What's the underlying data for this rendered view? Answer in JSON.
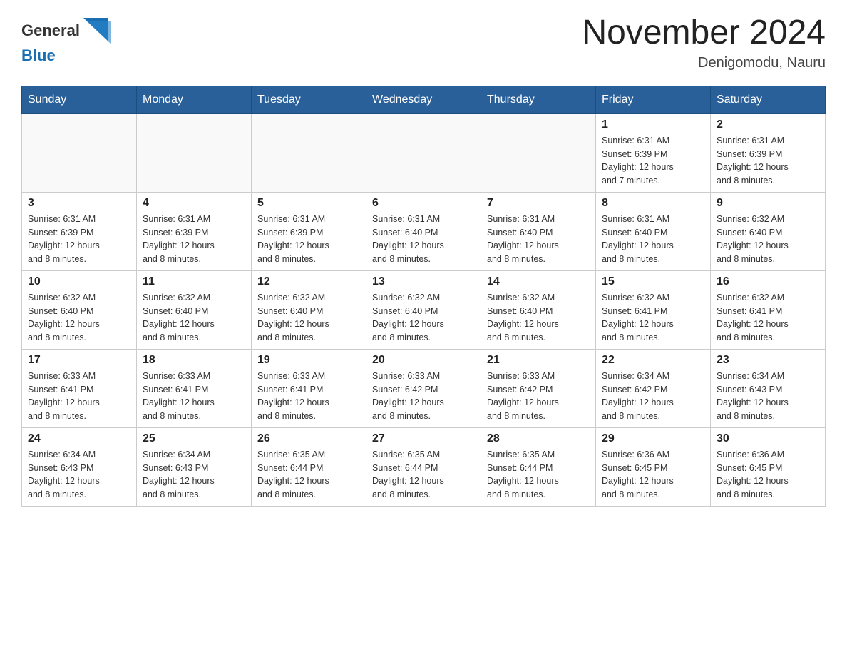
{
  "header": {
    "logo_general": "General",
    "logo_blue": "Blue",
    "month_title": "November 2024",
    "location": "Denigomodu, Nauru"
  },
  "weekdays": [
    "Sunday",
    "Monday",
    "Tuesday",
    "Wednesday",
    "Thursday",
    "Friday",
    "Saturday"
  ],
  "weeks": [
    [
      {
        "day": "",
        "info": ""
      },
      {
        "day": "",
        "info": ""
      },
      {
        "day": "",
        "info": ""
      },
      {
        "day": "",
        "info": ""
      },
      {
        "day": "",
        "info": ""
      },
      {
        "day": "1",
        "info": "Sunrise: 6:31 AM\nSunset: 6:39 PM\nDaylight: 12 hours\nand 7 minutes."
      },
      {
        "day": "2",
        "info": "Sunrise: 6:31 AM\nSunset: 6:39 PM\nDaylight: 12 hours\nand 8 minutes."
      }
    ],
    [
      {
        "day": "3",
        "info": "Sunrise: 6:31 AM\nSunset: 6:39 PM\nDaylight: 12 hours\nand 8 minutes."
      },
      {
        "day": "4",
        "info": "Sunrise: 6:31 AM\nSunset: 6:39 PM\nDaylight: 12 hours\nand 8 minutes."
      },
      {
        "day": "5",
        "info": "Sunrise: 6:31 AM\nSunset: 6:39 PM\nDaylight: 12 hours\nand 8 minutes."
      },
      {
        "day": "6",
        "info": "Sunrise: 6:31 AM\nSunset: 6:40 PM\nDaylight: 12 hours\nand 8 minutes."
      },
      {
        "day": "7",
        "info": "Sunrise: 6:31 AM\nSunset: 6:40 PM\nDaylight: 12 hours\nand 8 minutes."
      },
      {
        "day": "8",
        "info": "Sunrise: 6:31 AM\nSunset: 6:40 PM\nDaylight: 12 hours\nand 8 minutes."
      },
      {
        "day": "9",
        "info": "Sunrise: 6:32 AM\nSunset: 6:40 PM\nDaylight: 12 hours\nand 8 minutes."
      }
    ],
    [
      {
        "day": "10",
        "info": "Sunrise: 6:32 AM\nSunset: 6:40 PM\nDaylight: 12 hours\nand 8 minutes."
      },
      {
        "day": "11",
        "info": "Sunrise: 6:32 AM\nSunset: 6:40 PM\nDaylight: 12 hours\nand 8 minutes."
      },
      {
        "day": "12",
        "info": "Sunrise: 6:32 AM\nSunset: 6:40 PM\nDaylight: 12 hours\nand 8 minutes."
      },
      {
        "day": "13",
        "info": "Sunrise: 6:32 AM\nSunset: 6:40 PM\nDaylight: 12 hours\nand 8 minutes."
      },
      {
        "day": "14",
        "info": "Sunrise: 6:32 AM\nSunset: 6:40 PM\nDaylight: 12 hours\nand 8 minutes."
      },
      {
        "day": "15",
        "info": "Sunrise: 6:32 AM\nSunset: 6:41 PM\nDaylight: 12 hours\nand 8 minutes."
      },
      {
        "day": "16",
        "info": "Sunrise: 6:32 AM\nSunset: 6:41 PM\nDaylight: 12 hours\nand 8 minutes."
      }
    ],
    [
      {
        "day": "17",
        "info": "Sunrise: 6:33 AM\nSunset: 6:41 PM\nDaylight: 12 hours\nand 8 minutes."
      },
      {
        "day": "18",
        "info": "Sunrise: 6:33 AM\nSunset: 6:41 PM\nDaylight: 12 hours\nand 8 minutes."
      },
      {
        "day": "19",
        "info": "Sunrise: 6:33 AM\nSunset: 6:41 PM\nDaylight: 12 hours\nand 8 minutes."
      },
      {
        "day": "20",
        "info": "Sunrise: 6:33 AM\nSunset: 6:42 PM\nDaylight: 12 hours\nand 8 minutes."
      },
      {
        "day": "21",
        "info": "Sunrise: 6:33 AM\nSunset: 6:42 PM\nDaylight: 12 hours\nand 8 minutes."
      },
      {
        "day": "22",
        "info": "Sunrise: 6:34 AM\nSunset: 6:42 PM\nDaylight: 12 hours\nand 8 minutes."
      },
      {
        "day": "23",
        "info": "Sunrise: 6:34 AM\nSunset: 6:43 PM\nDaylight: 12 hours\nand 8 minutes."
      }
    ],
    [
      {
        "day": "24",
        "info": "Sunrise: 6:34 AM\nSunset: 6:43 PM\nDaylight: 12 hours\nand 8 minutes."
      },
      {
        "day": "25",
        "info": "Sunrise: 6:34 AM\nSunset: 6:43 PM\nDaylight: 12 hours\nand 8 minutes."
      },
      {
        "day": "26",
        "info": "Sunrise: 6:35 AM\nSunset: 6:44 PM\nDaylight: 12 hours\nand 8 minutes."
      },
      {
        "day": "27",
        "info": "Sunrise: 6:35 AM\nSunset: 6:44 PM\nDaylight: 12 hours\nand 8 minutes."
      },
      {
        "day": "28",
        "info": "Sunrise: 6:35 AM\nSunset: 6:44 PM\nDaylight: 12 hours\nand 8 minutes."
      },
      {
        "day": "29",
        "info": "Sunrise: 6:36 AM\nSunset: 6:45 PM\nDaylight: 12 hours\nand 8 minutes."
      },
      {
        "day": "30",
        "info": "Sunrise: 6:36 AM\nSunset: 6:45 PM\nDaylight: 12 hours\nand 8 minutes."
      }
    ]
  ]
}
